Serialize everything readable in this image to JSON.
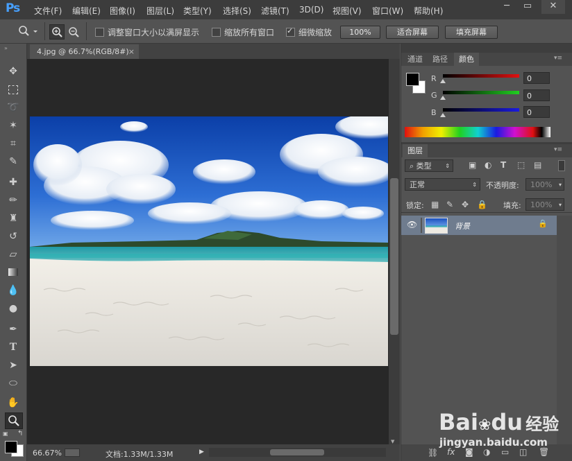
{
  "app": {
    "logo": "Ps"
  },
  "menu": [
    "文件(F)",
    "编辑(E)",
    "图像(I)",
    "图层(L)",
    "类型(Y)",
    "选择(S)",
    "滤镜(T)",
    "3D(D)",
    "视图(V)",
    "窗口(W)",
    "帮助(H)"
  ],
  "window_controls": {
    "minimize": "─",
    "restore": "▭",
    "close": "✕"
  },
  "options": {
    "resize_windows_label": "调整窗口大小以满屏显示",
    "zoom_all_label": "缩放所有窗口",
    "scrubby_zoom_label": "细微缩放",
    "btn_100": "100%",
    "btn_fit": "适合屏幕",
    "btn_fill": "填充屏幕",
    "resize_windows_checked": false,
    "zoom_all_checked": false,
    "scrubby_checked": true
  },
  "document": {
    "tab_title": "4.jpg @ 66.7%(RGB/8#)",
    "tab_close": "×"
  },
  "status": {
    "zoom": "66.67%",
    "doc_info": "文档:1.33M/1.33M",
    "arrow": "▶"
  },
  "color_panel": {
    "tabs": [
      "通道",
      "路径",
      "颜色"
    ],
    "active_tab": "颜色",
    "channels": [
      {
        "label": "R",
        "value": "0",
        "color": "#d11a1a"
      },
      {
        "label": "G",
        "value": "0",
        "color": "#1ec41e"
      },
      {
        "label": "B",
        "value": "0",
        "color": "#1a1ad1"
      }
    ]
  },
  "layers_panel": {
    "tab": "图层",
    "filter_label": "类型",
    "blend_mode": "正常",
    "opacity_label": "不透明度:",
    "opacity_value": "100%",
    "lock_label": "锁定:",
    "fill_label": "填充:",
    "fill_value": "100%",
    "layers": [
      {
        "name": "背景",
        "visible": true,
        "locked": true
      }
    ]
  },
  "watermark": {
    "brand": "Bai",
    "brand2": "du",
    "suffix": "经验",
    "url": "jingyan.baidu.com"
  }
}
